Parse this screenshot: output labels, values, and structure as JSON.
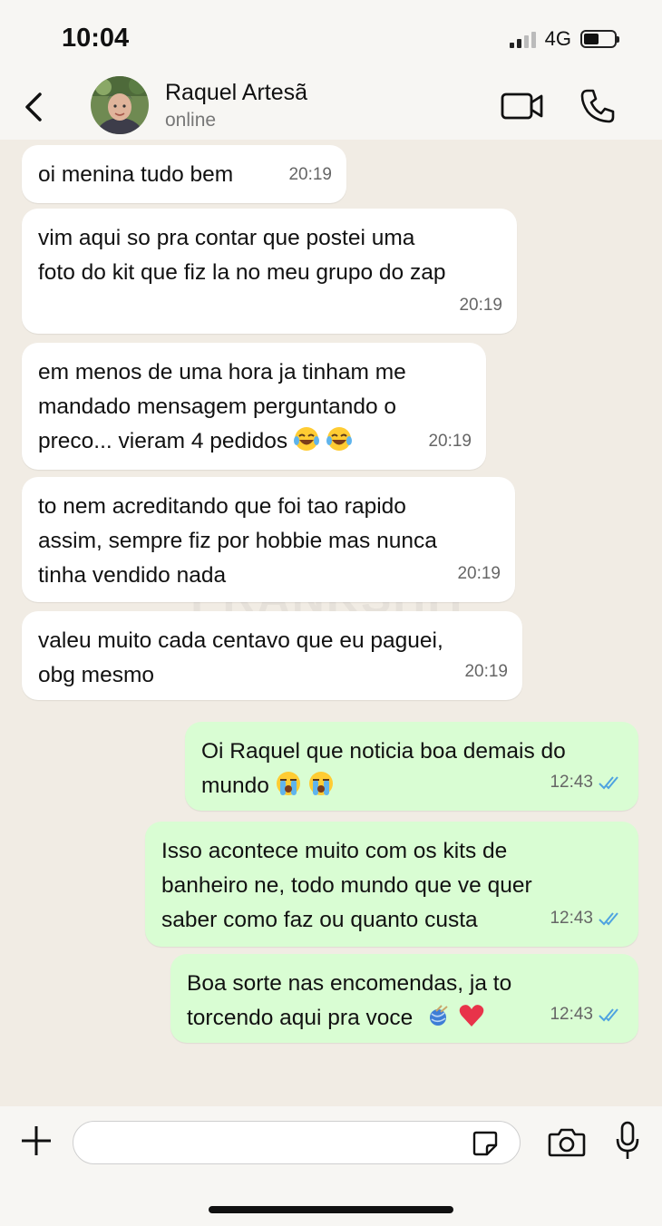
{
  "status_bar": {
    "time": "10:04",
    "network": "4G"
  },
  "header": {
    "contact_name": "Raquel Artesã",
    "status": "online",
    "back_icon": "chevron-left-icon",
    "video_icon": "video-camera-icon",
    "phone_icon": "phone-icon"
  },
  "watermark": "PRANKSHIT",
  "messages": [
    {
      "direction": "in",
      "lines": [
        "oi menina tudo bem"
      ],
      "time": "20:19"
    },
    {
      "direction": "in",
      "lines": [
        "vim aqui so pra contar que postei uma",
        "foto do kit que fiz la no meu grupo do zap"
      ],
      "time": "20:19"
    },
    {
      "direction": "in",
      "lines": [
        "em menos de uma hora ja tinham me",
        "mandado mensagem perguntando o",
        "preco... vieram 4 pedidos"
      ],
      "emojis": [
        "tears-of-joy",
        "tears-of-joy"
      ],
      "time": "20:19"
    },
    {
      "direction": "in",
      "lines": [
        "to nem acreditando que foi tao rapido",
        "assim, sempre fiz por hobbie mas nunca",
        "tinha vendido nada"
      ],
      "time": "20:19"
    },
    {
      "direction": "in",
      "lines": [
        "valeu muito cada centavo que eu paguei,",
        "obg mesmo"
      ],
      "time": "20:19"
    },
    {
      "direction": "out",
      "lines": [
        "Oi Raquel que noticia boa demais do",
        "mundo"
      ],
      "emojis": [
        "loudly-crying",
        "loudly-crying"
      ],
      "time": "12:43",
      "read": true
    },
    {
      "direction": "out",
      "lines": [
        "Isso acontece muito com os kits de",
        "banheiro ne, todo mundo que ve quer",
        "saber como faz ou quanto custa"
      ],
      "time": "12:43",
      "read": true
    },
    {
      "direction": "out",
      "lines": [
        "Boa sorte nas encomendas, ja to",
        "torcendo aqui pra voce"
      ],
      "emojis": [
        "yarn",
        "red-heart"
      ],
      "time": "12:43",
      "read": true
    }
  ],
  "composer": {
    "input_value": "",
    "plus_icon": "plus-icon",
    "sticker_icon": "sticker-icon",
    "camera_icon": "camera-icon",
    "mic_icon": "microphone-icon"
  },
  "colors": {
    "incoming_bubble": "#ffffff",
    "outgoing_bubble": "#d9fdd3",
    "read_ticks": "#4fa3e0",
    "chat_background": "#f1ece4"
  }
}
